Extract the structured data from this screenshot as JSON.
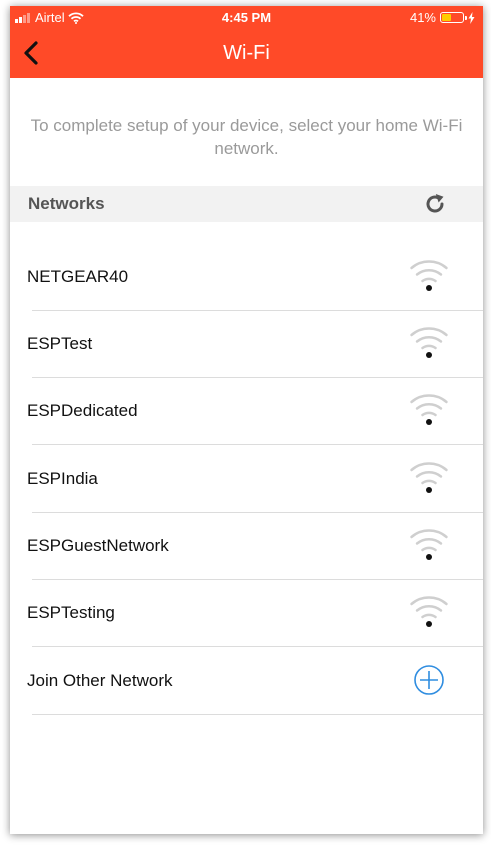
{
  "status_bar": {
    "carrier": "Airtel",
    "time": "4:45 PM",
    "battery": "41%"
  },
  "header": {
    "title": "Wi-Fi"
  },
  "instructions": "To complete setup of your device, select your home Wi-Fi network.",
  "networks_section": {
    "label": "Networks"
  },
  "networks": [
    {
      "name": "NETGEAR40"
    },
    {
      "name": "ESPTest"
    },
    {
      "name": "ESPDedicated"
    },
    {
      "name": "ESPIndia"
    },
    {
      "name": "ESPGuestNetwork"
    },
    {
      "name": "ESPTesting"
    }
  ],
  "join_other": {
    "label": "Join Other Network"
  },
  "colors": {
    "header_bg": "#ff4a28",
    "accent_blue": "#2f8de0",
    "battery_fill": "#ffcc00"
  },
  "icons": {
    "back": "chevron-left-icon",
    "refresh": "refresh-icon",
    "network": "wifi-icon",
    "join": "plus-circle-icon"
  }
}
